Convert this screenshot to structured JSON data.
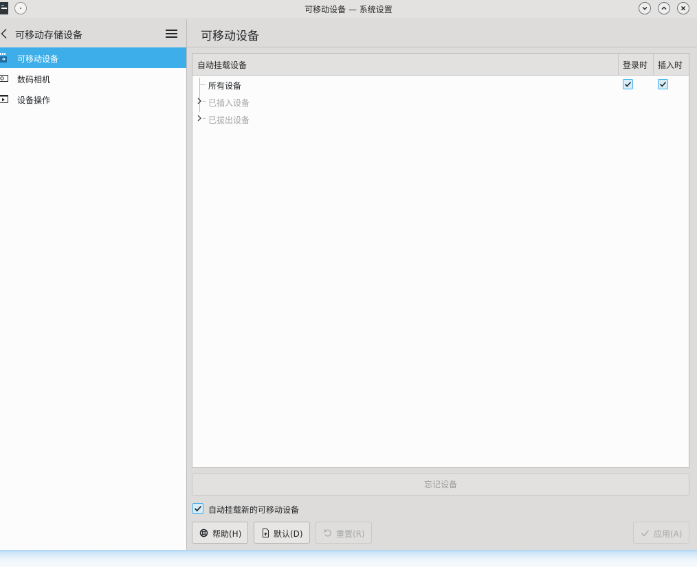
{
  "window": {
    "title": "可移动设备 — 系统设置"
  },
  "sidebar": {
    "title": "可移动存储设备",
    "items": [
      {
        "label": "可移动设备",
        "icon": "removable-device-icon",
        "selected": true
      },
      {
        "label": "数码相机",
        "icon": "camera-icon",
        "selected": false
      },
      {
        "label": "设备操作",
        "icon": "device-actions-icon",
        "selected": false
      }
    ]
  },
  "main": {
    "title": "可移动设备",
    "tree": {
      "columns": [
        "自动挂载设备",
        "登录时",
        "插入时"
      ],
      "rows": [
        {
          "label": "所有设备",
          "expandable": false,
          "enabled": true,
          "on_login": true,
          "on_attach": true
        },
        {
          "label": "已插入设备",
          "expandable": true,
          "enabled": false
        },
        {
          "label": "已拔出设备",
          "expandable": true,
          "enabled": false
        }
      ]
    },
    "forget_button": "忘记设备",
    "automount_new": {
      "label": "自动挂载新的可移动设备",
      "checked": true
    }
  },
  "buttons": {
    "help": "帮助(H)",
    "defaults": "默认(D)",
    "reset": "重置(R)",
    "apply": "应用(A)"
  },
  "colors": {
    "accent": "#3daee9",
    "window_bg": "#dedcda",
    "view_bg": "#fcfcfc"
  }
}
